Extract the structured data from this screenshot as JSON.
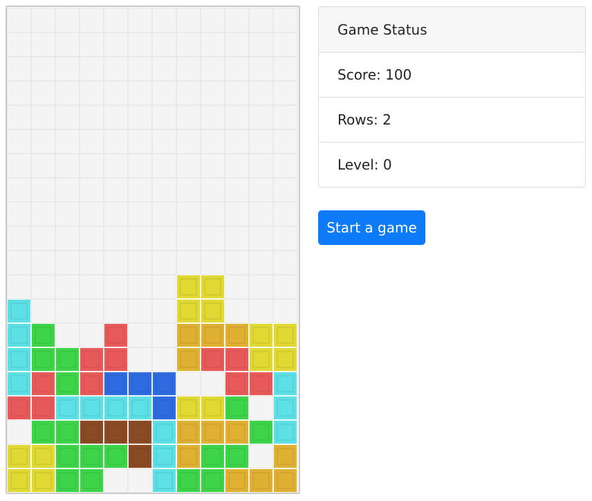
{
  "status": {
    "title": "Game Status",
    "score": "Score: 100",
    "rows": "Rows: 2",
    "level": "Level: 0"
  },
  "start_button_label": "Start a game",
  "colors": {
    "Y": "#e0d833",
    "C": "#5ce0e6",
    "G": "#3dd44a",
    "R": "#e85a5a",
    "B": "#2f6be0",
    "O": "#e0b033",
    "N": "#8a4a24"
  },
  "board": {
    "columns": 12,
    "rows": 20,
    "grid": [
      "............",
      "............",
      "............",
      "............",
      "............",
      "............",
      "............",
      "............",
      "............",
      "............",
      "............",
      ".......YY...",
      "C......YY...",
      "CG..R..OOOYY",
      "CGGRR..ORRYY",
      "CRGRBBB..RRC",
      "RRCCCCBYYG.C",
      ".GGNNNCOOOGC",
      "YYGGGNCOGG.O",
      "YYGG..CGGOOO"
    ]
  }
}
